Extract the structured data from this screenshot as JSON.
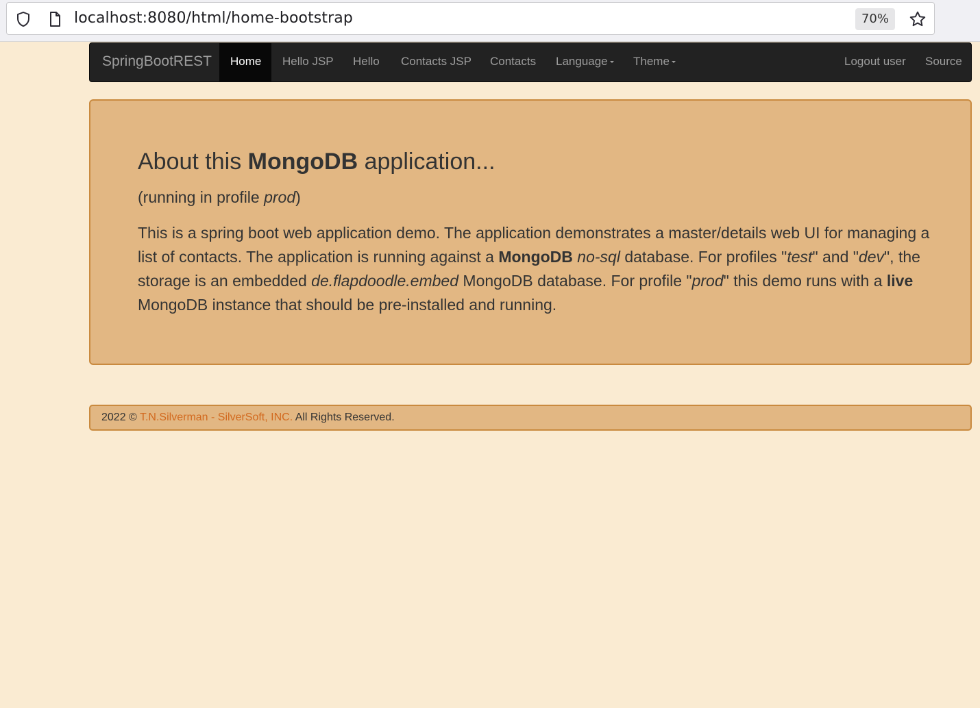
{
  "browser": {
    "url": "localhost:8080/html/home-bootstrap",
    "zoom": "70%"
  },
  "navbar": {
    "brand": "SpringBootREST",
    "items": [
      {
        "label": "Home",
        "active": true
      },
      {
        "label": "Hello JSP"
      },
      {
        "label": "Hello"
      },
      {
        "label": "Contacts JSP"
      },
      {
        "label": "Contacts"
      },
      {
        "label": "Language",
        "dropdown": true
      },
      {
        "label": "Theme",
        "dropdown": true
      }
    ],
    "right_items": [
      {
        "label": "Logout user"
      },
      {
        "label": "Source"
      }
    ]
  },
  "jumbotron": {
    "heading_pre": "About this ",
    "heading_bold": "MongoDB",
    "heading_post": " application...",
    "profile_pre": "(running in profile ",
    "profile_name": "prod",
    "profile_post": ")",
    "desc": {
      "p1": "This is a spring boot web application demo. The application demonstrates a master/details web UI for managing a list of contacts. The application is running against a ",
      "b1": "MongoDB",
      "p2": " ",
      "i1": "no-sql",
      "p3": " database. For profiles \"",
      "i2": "test",
      "p4": "\" and \"",
      "i3": "dev",
      "p5": "\", the storage is an embedded ",
      "i4": "de.flapdoodle.embed",
      "p6": " MongoDB database. For profile \"",
      "i5": "prod",
      "p7": "\" this demo runs with a ",
      "b2": "live",
      "p8": " MongoDB instance that should be pre-installed and running."
    }
  },
  "footer": {
    "year": "2022 ©",
    "link": "T.N.Silverman - SilverSoft, INC.",
    "rights": "All Rights Reserved."
  },
  "colors": {
    "page_bg": "#faebd2",
    "navbar_bg": "#222222",
    "panel_bg": "#e2b783",
    "panel_border": "#c98a3f",
    "link": "#d2691e"
  }
}
